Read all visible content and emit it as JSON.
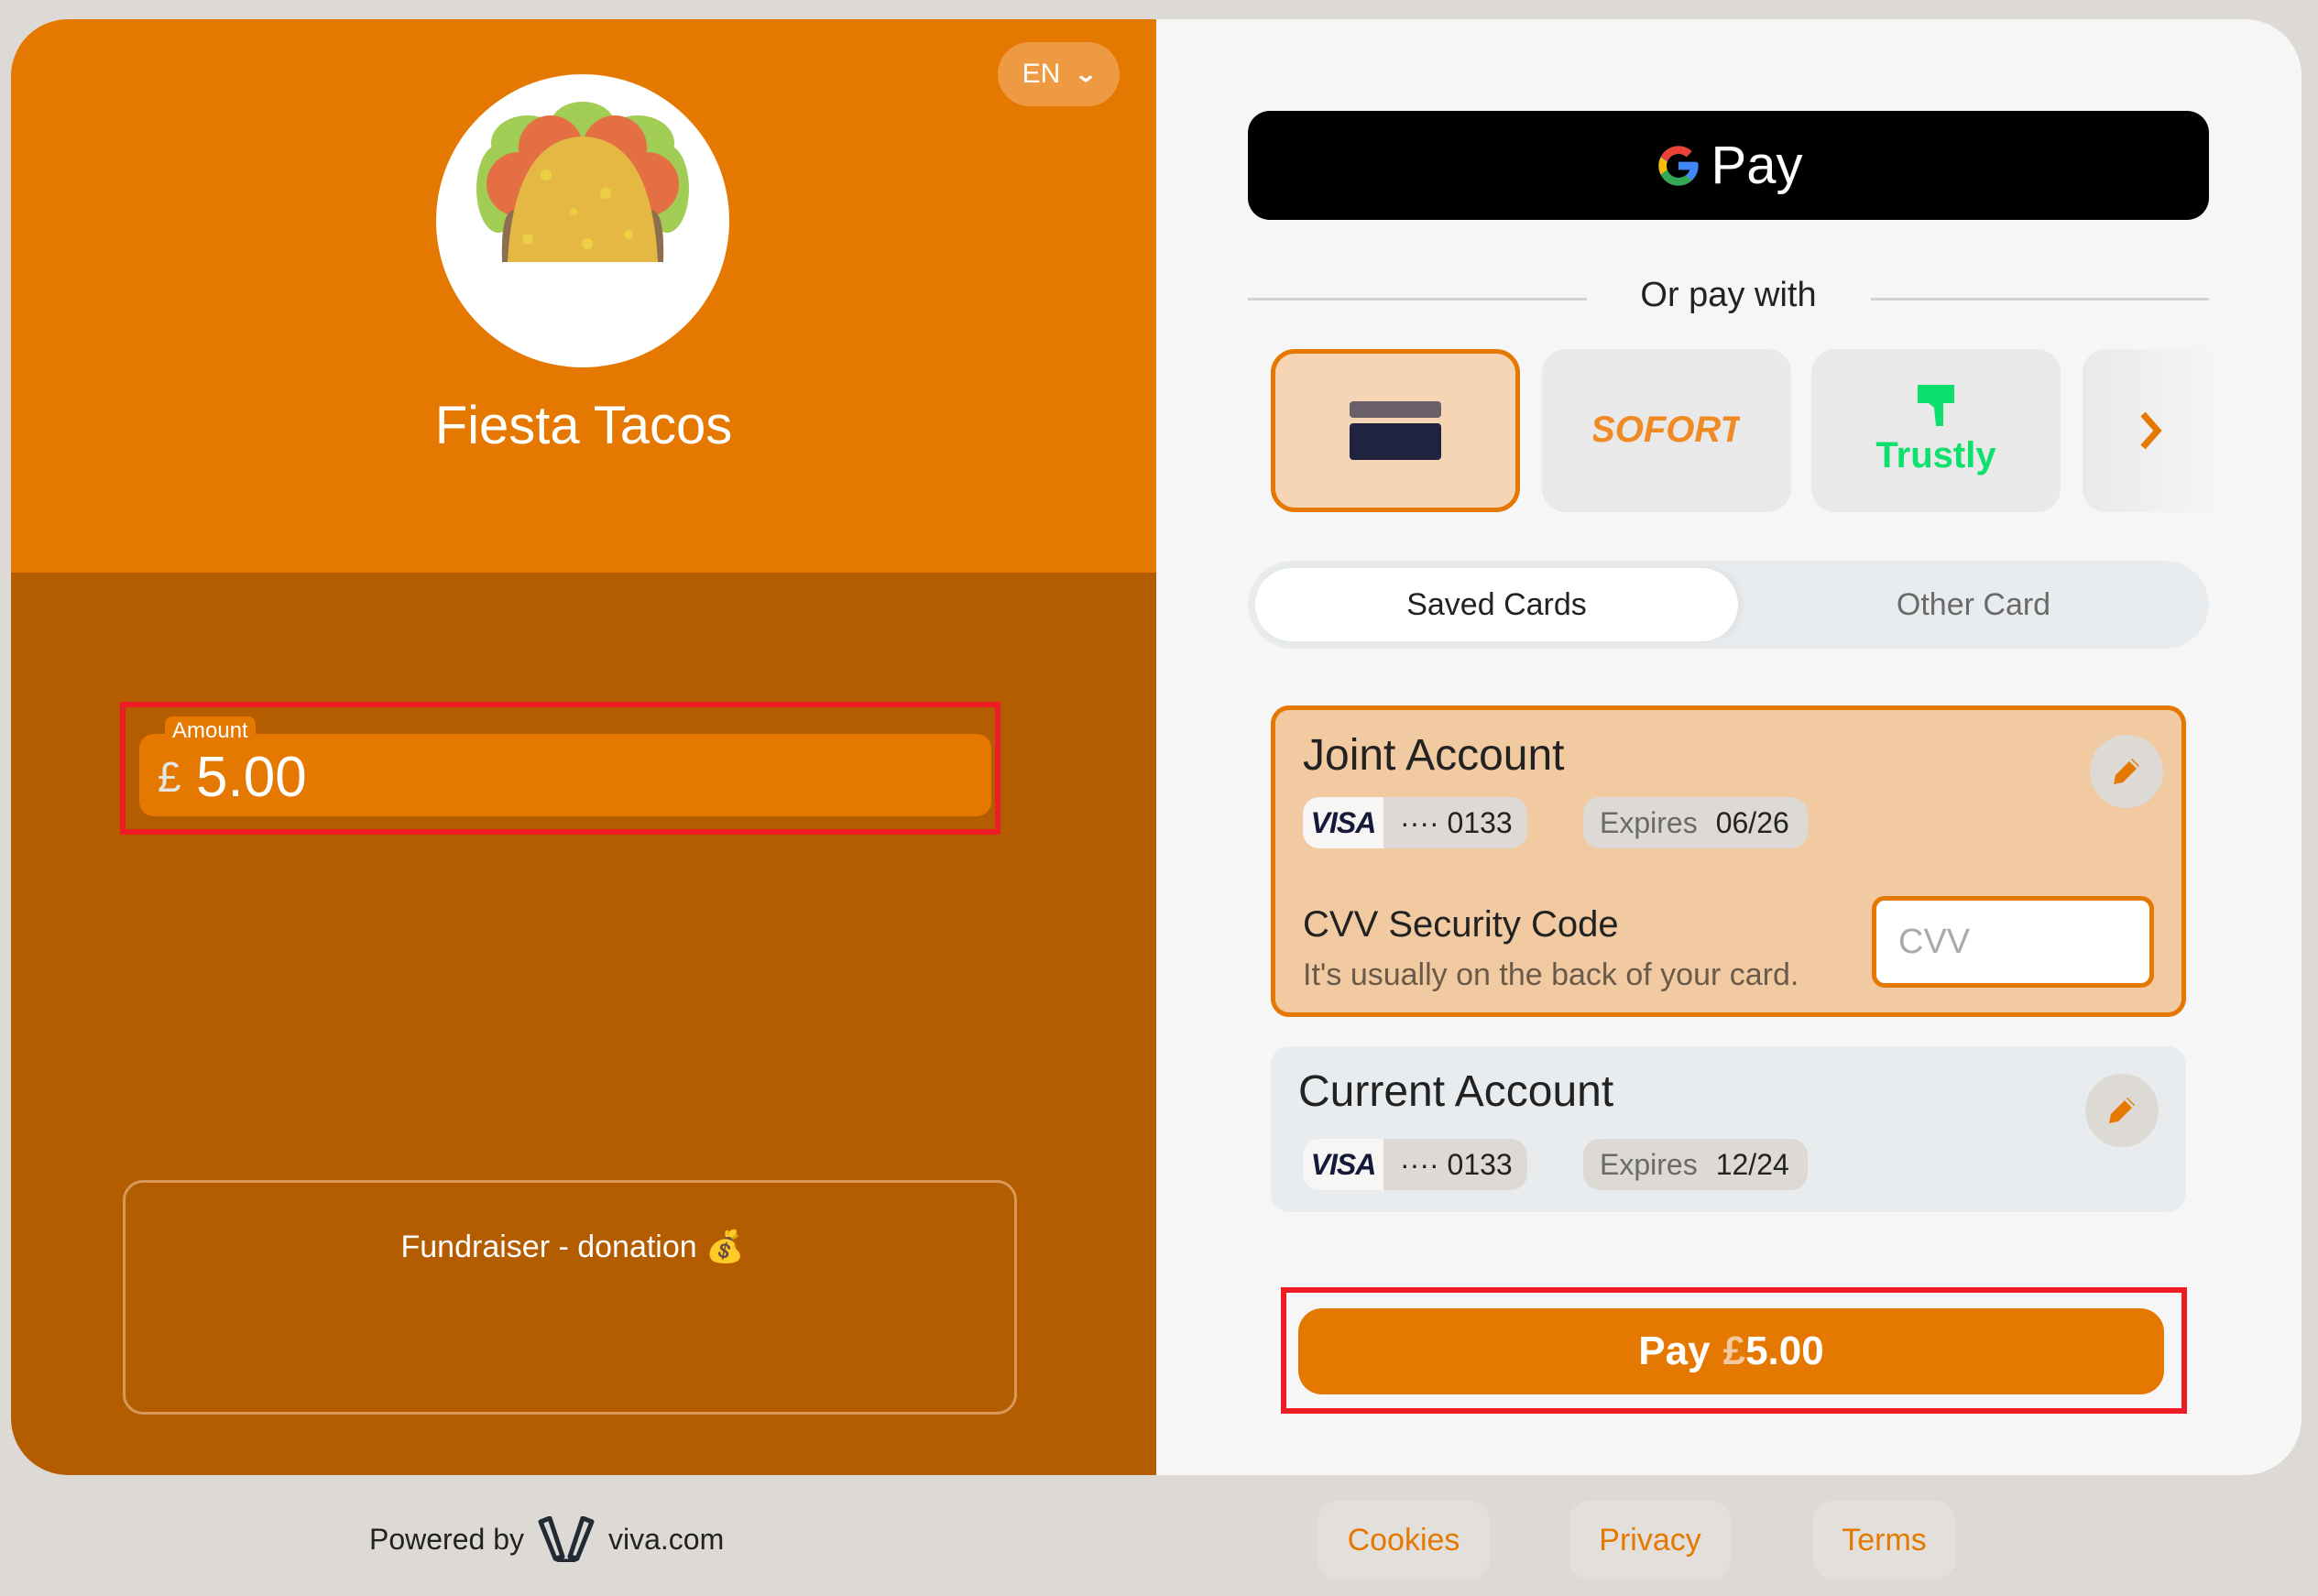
{
  "merchant": {
    "name": "Fiesta Tacos",
    "logo_icon": "taco-icon"
  },
  "language": {
    "selected": "EN"
  },
  "donation": {
    "label": "Fundraiser - donation",
    "emoji": "💰",
    "amount_label": "Amount",
    "currency_symbol": "£",
    "amount_value": "5.00"
  },
  "gpay": {
    "label": "Pay"
  },
  "divider": {
    "text": "Or pay with"
  },
  "payment_methods": [
    {
      "name": "card",
      "selected": true
    },
    {
      "name": "SOFORT",
      "selected": false
    },
    {
      "name": "Trustly",
      "selected": false
    },
    {
      "name": "more",
      "selected": false
    }
  ],
  "tabs": {
    "saved": "Saved Cards",
    "other": "Other Card",
    "active": "Saved Cards"
  },
  "saved_cards": [
    {
      "name": "Joint Account",
      "brand": "VISA",
      "masked": "····",
      "last4": "0133",
      "expires_label": "Expires",
      "expires": "06/26",
      "selected": true
    },
    {
      "name": "Current Account",
      "brand": "VISA",
      "masked": "····",
      "last4": "0133",
      "expires_label": "Expires",
      "expires": "12/24",
      "selected": false
    }
  ],
  "cvv": {
    "title": "CVV Security Code",
    "help": "It's usually on the back of your card.",
    "placeholder": "CVV",
    "value": ""
  },
  "pay_button": {
    "prefix": "Pay",
    "currency": "£",
    "amount": "5.00"
  },
  "footer": {
    "powered_by": "Powered by",
    "brand": "viva.com",
    "links": [
      "Cookies",
      "Privacy",
      "Terms"
    ]
  },
  "colors": {
    "brand_orange": "#e57800",
    "dark_orange": "#b35d00",
    "highlight_red": "#ee1c25",
    "trustly_green": "#0ee06e",
    "sofort_orange": "#f08a24"
  }
}
